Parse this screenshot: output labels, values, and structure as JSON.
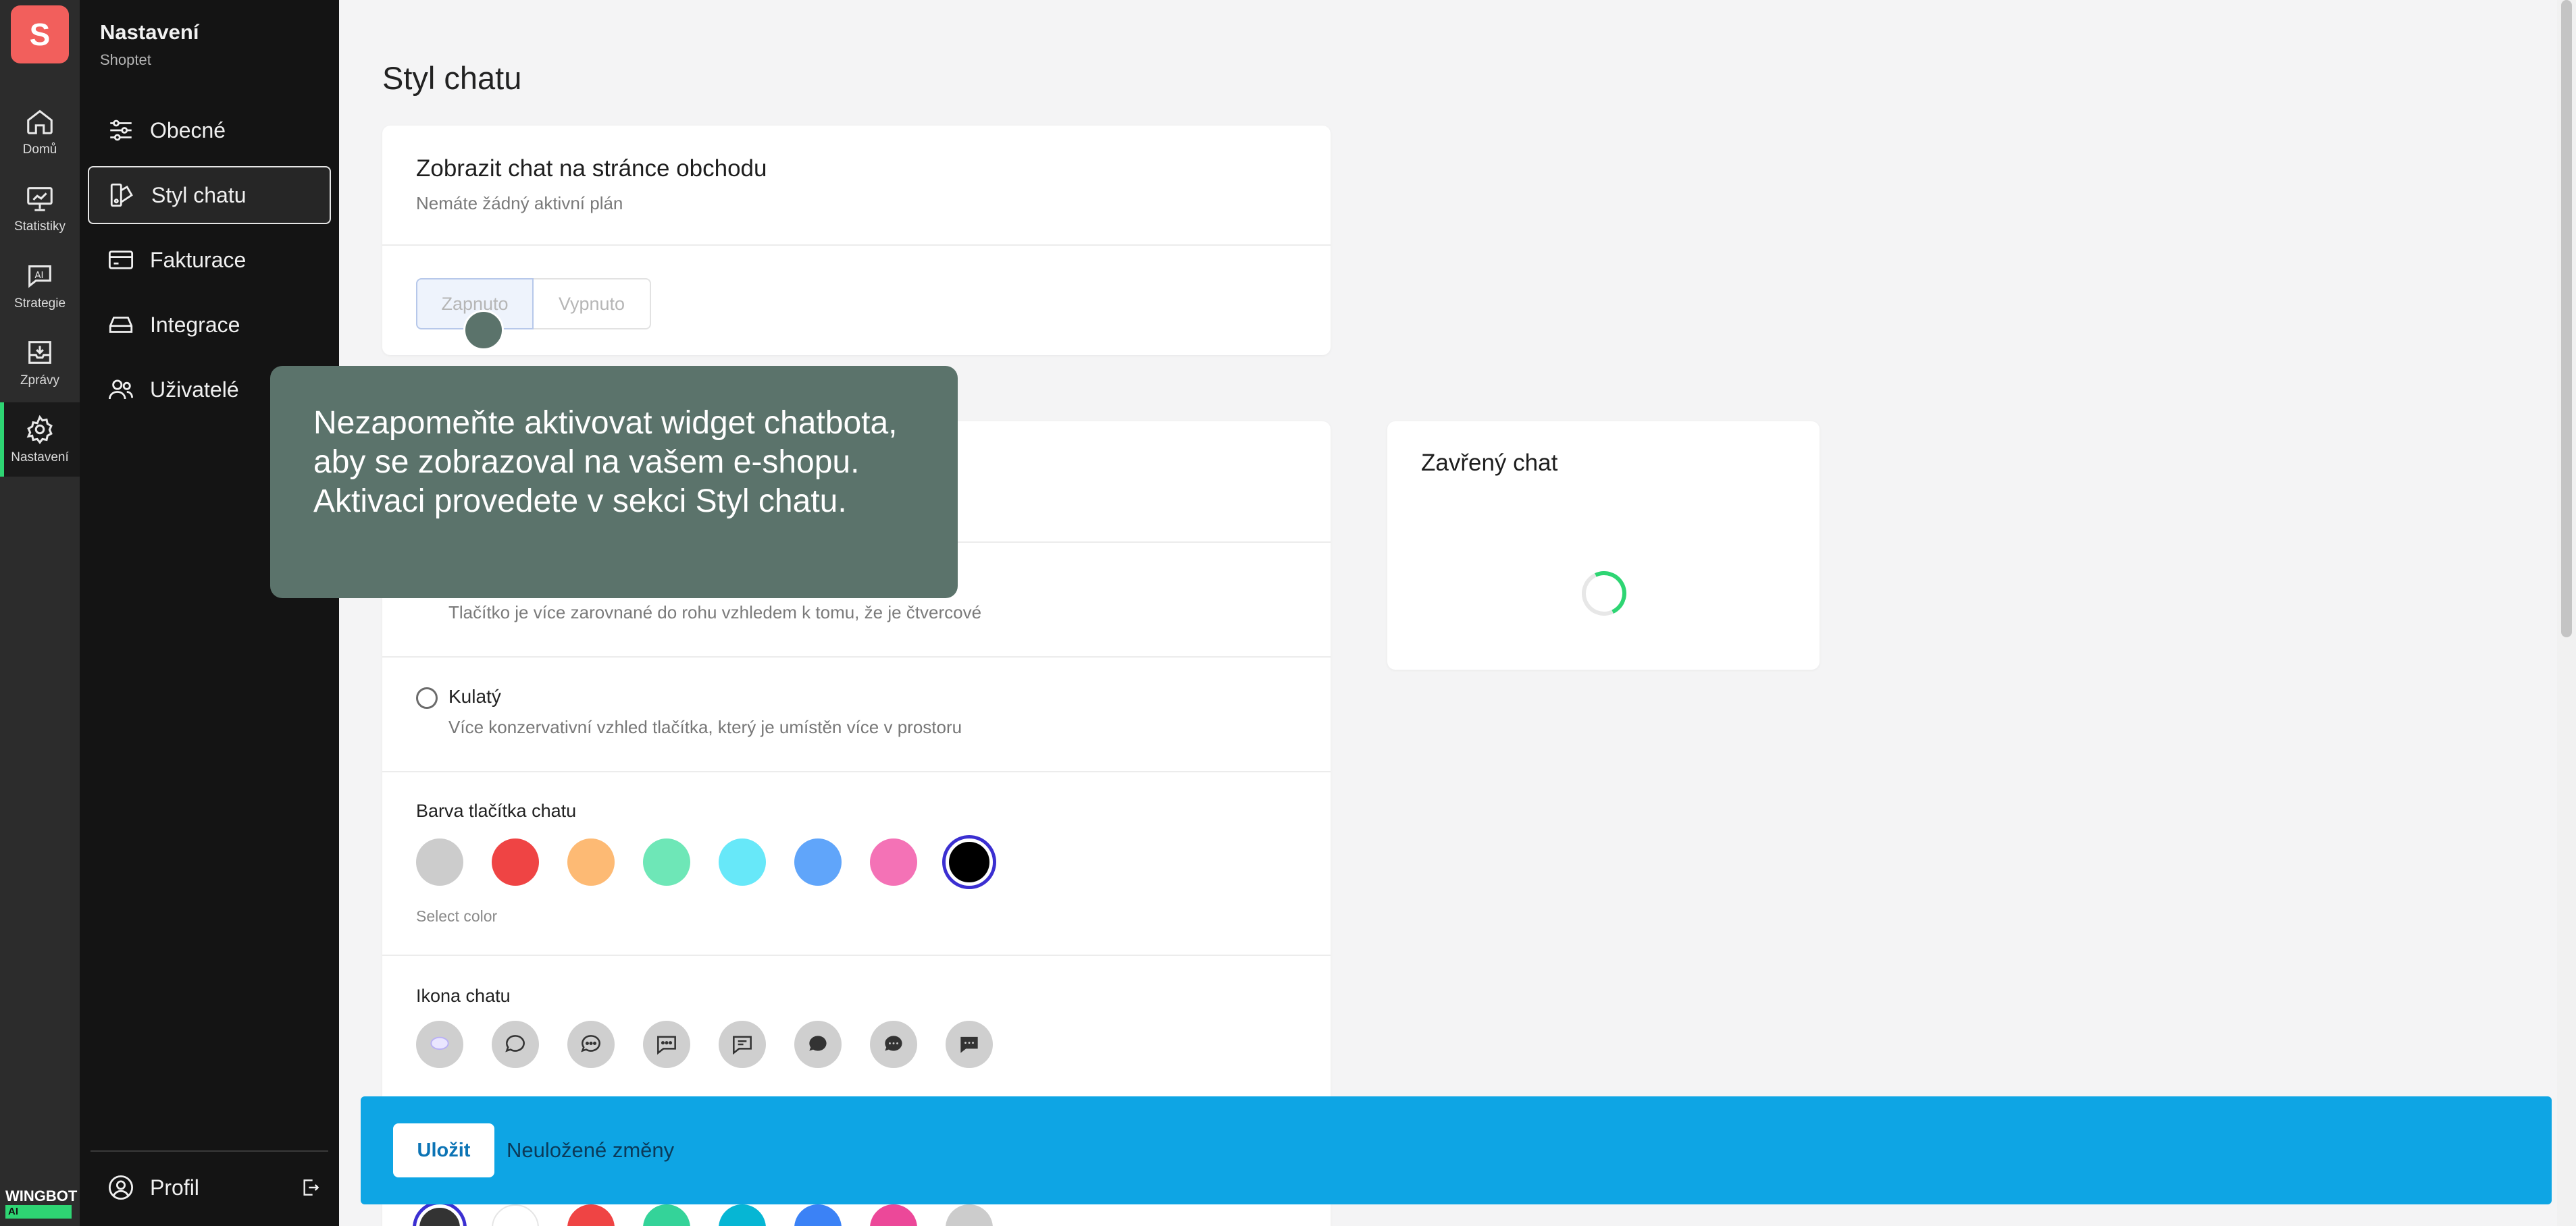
{
  "rail": {
    "logo_letter": "S",
    "items": [
      {
        "label": "Domů",
        "icon": "home-icon"
      },
      {
        "label": "Statistiky",
        "icon": "chart-board-icon"
      },
      {
        "label": "Strategie",
        "icon": "ai-chat-icon"
      },
      {
        "label": "Zprávy",
        "icon": "inbox-icon"
      },
      {
        "label": "Nastavení",
        "icon": "gear-icon"
      }
    ],
    "brand": "WINGBOT",
    "brand_ai": "AI"
  },
  "sidebar": {
    "title": "Nastavení",
    "subtitle": "Shoptet",
    "items": [
      {
        "label": "Obecné",
        "icon": "sliders-icon"
      },
      {
        "label": "Styl chatu",
        "icon": "palette-icon"
      },
      {
        "label": "Fakturace",
        "icon": "credit-card-icon"
      },
      {
        "label": "Integrace",
        "icon": "hard-drive-icon"
      },
      {
        "label": "Uživatelé",
        "icon": "users-icon"
      }
    ],
    "profile_label": "Profil"
  },
  "main": {
    "page_title": "Styl chatu",
    "visibility_card": {
      "heading": "Zobrazit chat na stránce obchodu",
      "subtext": "Nemáte žádný aktivní plán",
      "toggle_on": "Zapnuto",
      "toggle_off": "Vypnuto"
    },
    "style_card": {
      "square_desc": "Tlačítko je více zarovnané do rohu vzhledem k tomu, že je čtvercové",
      "round_label": "Kulatý",
      "round_desc": "Více konzervativní vzhled tlačítka, který je umístěn více v prostoru",
      "button_color_label": "Barva tlačítka chatu",
      "button_colors": [
        "#cccccc",
        "#ef4444",
        "#fdba74",
        "#6ee7b7",
        "#67e8f9",
        "#60a5fa",
        "#f472b6",
        "#000000"
      ],
      "select_color_hint": "Select color",
      "icon_label": "Ikona chatu",
      "bottom_colors": [
        "#333333",
        "#ffffff",
        "#ef4444",
        "#34d399",
        "#06b6d4",
        "#3b82f6",
        "#ec4899",
        "#cccccc"
      ]
    },
    "preview_card": {
      "heading": "Zavřený chat"
    }
  },
  "tooltip": {
    "text": "Nezapomeňte aktivovat widget chatbota, aby se zobrazoval na vašem e-shopu. Aktivaci provedete v sekci Styl chatu."
  },
  "savebar": {
    "save_label": "Uložit",
    "message": "Neuložené změny"
  }
}
